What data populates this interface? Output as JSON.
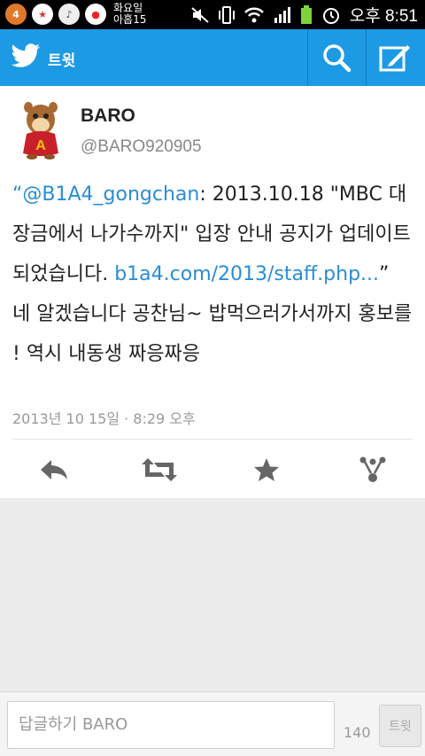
{
  "statusbar": {
    "notif_count": "4",
    "date_line1": "화요일",
    "date_line2": "아홉15",
    "time": "오후 8:51"
  },
  "appbar": {
    "title": "트윗"
  },
  "tweet": {
    "name": "BARO",
    "handle": "@BARO920905",
    "open_quote": "“",
    "mention": "@B1A4_gongchan",
    "text_part1": ": 2013.10.18 \"MBC 대장금에서 나가수까지\" 입장 안내 공지가 업데이트 되었습니다.",
    "link": "b1a4.com/2013/staff.php...",
    "close_quote": "”",
    "text_part2": " 네 알겠습니다 공찬님~ 밥먹으러가서까지 홍보를 ! 역시 내동생 짜응짜응",
    "timestamp": "2013년 10 15일 · 8:29 오후"
  },
  "composer": {
    "placeholder": "답글하기 BARO",
    "char_count": "140",
    "send_label": "트윗"
  },
  "colors": {
    "accent": "#1d9ae4",
    "link": "#2a8dd4"
  }
}
